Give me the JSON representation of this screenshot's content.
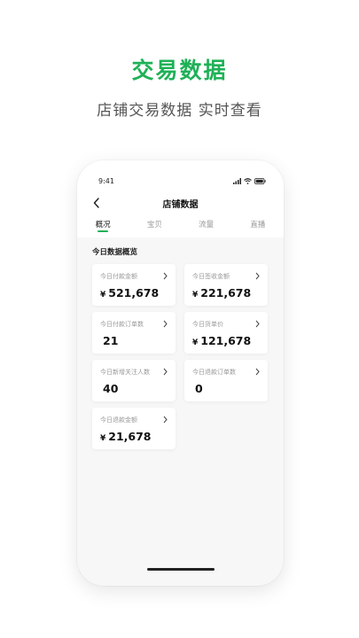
{
  "page": {
    "headline": "交易数据",
    "subline": "店铺交易数据 实时查看"
  },
  "colors": {
    "accent": "#1fb157"
  },
  "phone": {
    "status": {
      "time": "9:41",
      "icons": [
        "signal-icon",
        "wifi-icon",
        "battery-icon"
      ]
    },
    "nav": {
      "title": "店铺数据",
      "back_icon": "chevron-left-icon"
    },
    "tabs": [
      {
        "label": "概况",
        "active": true
      },
      {
        "label": "宝贝",
        "active": false
      },
      {
        "label": "流量",
        "active": false
      },
      {
        "label": "直播",
        "active": false
      }
    ],
    "section_title": "今日数据概览",
    "cards": [
      {
        "label": "今日付款金额",
        "currency": "¥",
        "value": "521,678"
      },
      {
        "label": "今日签收金额",
        "currency": "¥",
        "value": "221,678"
      },
      {
        "label": "今日付款订单数",
        "currency": "",
        "value": "21"
      },
      {
        "label": "今日货单价",
        "currency": "¥",
        "value": "121,678"
      },
      {
        "label": "今日新增关注人数",
        "currency": "",
        "value": "40"
      },
      {
        "label": "今日退款订单数",
        "currency": "",
        "value": "0"
      },
      {
        "label": "今日退款金额",
        "currency": "¥",
        "value": "21,678"
      }
    ]
  }
}
